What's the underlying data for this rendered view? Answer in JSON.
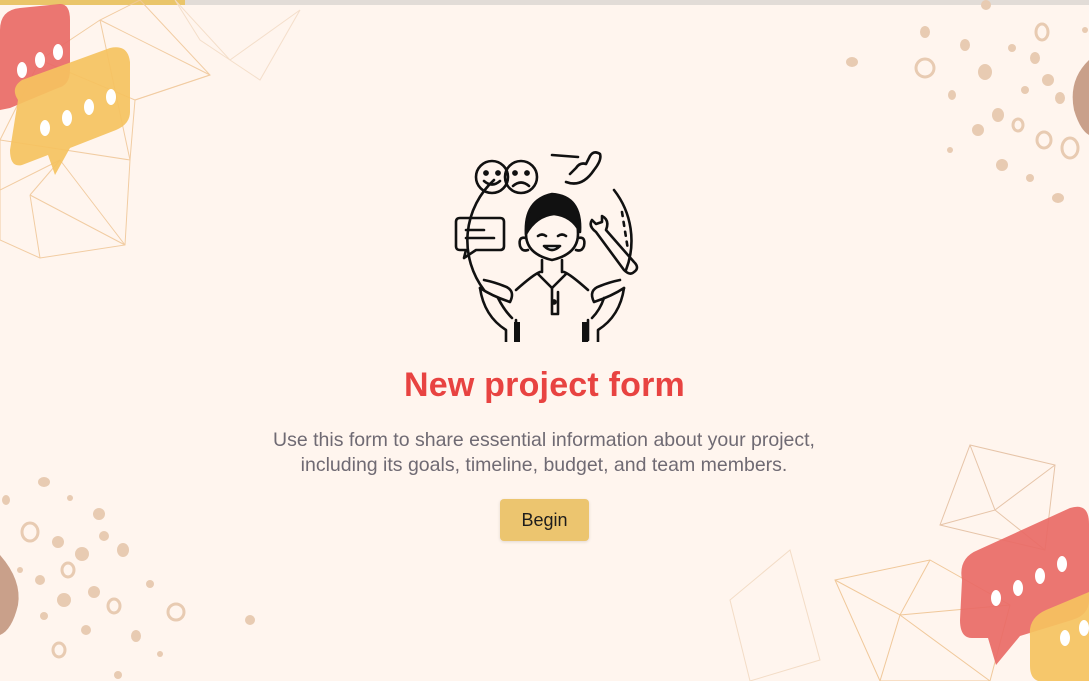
{
  "progress": {
    "value_percent": 17,
    "fill_color": "#eac56a",
    "track_color": "#e2dcd7"
  },
  "intro": {
    "title": "New project form",
    "description_lines": [
      "Use this form to share essential information about your project,",
      "including its goals, timeline, budget, and team members."
    ],
    "begin_label": "Begin"
  },
  "theme": {
    "background": "#fff5ee",
    "title_color": "#e84341",
    "text_color": "#6f6a73",
    "button_color": "#ecc56f"
  },
  "icons": {
    "hero": "customer-support-person-icon",
    "decor": [
      "speech-bubble-icon",
      "polygon-mesh-decoration",
      "dots-decoration"
    ]
  }
}
